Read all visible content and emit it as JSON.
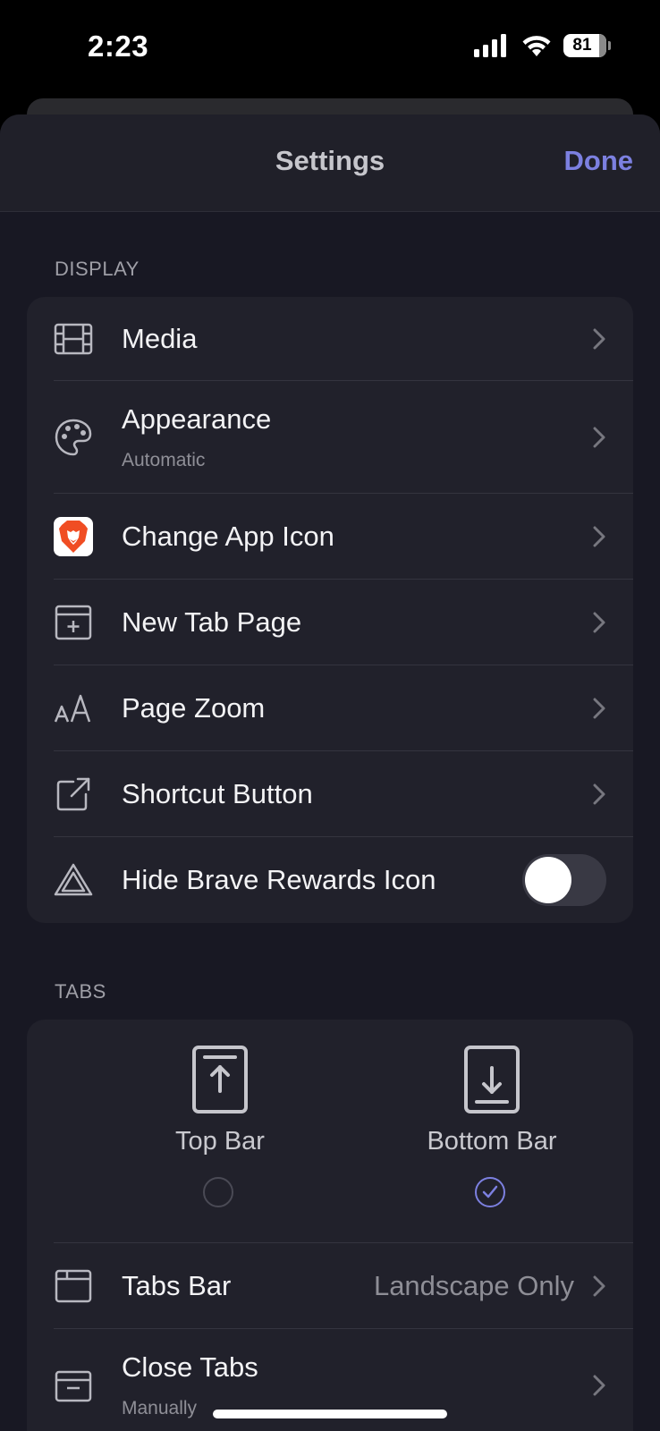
{
  "status_bar": {
    "time": "2:23",
    "battery": "81",
    "icons": [
      "cellular-signal-icon",
      "wifi-icon",
      "battery-icon"
    ]
  },
  "nav": {
    "title": "Settings",
    "done_label": "Done"
  },
  "display_section": {
    "header": "DISPLAY",
    "items": [
      {
        "label": "Media",
        "icon": "film-icon"
      },
      {
        "label": "Appearance",
        "subtitle": "Automatic",
        "icon": "palette-icon"
      },
      {
        "label": "Change App Icon",
        "icon": "brave-lion-icon"
      },
      {
        "label": "New Tab Page",
        "icon": "new-tab-icon"
      },
      {
        "label": "Page Zoom",
        "icon": "text-size-icon"
      },
      {
        "label": "Shortcut Button",
        "icon": "external-link-icon"
      },
      {
        "label": "Hide Brave Rewards Icon",
        "icon": "brave-rewards-icon",
        "toggle_on": false
      }
    ]
  },
  "tabs_section": {
    "header": "TABS",
    "bar_options": [
      {
        "label": "Top Bar",
        "selected": false,
        "icon": "top-bar-icon"
      },
      {
        "label": "Bottom Bar",
        "selected": true,
        "icon": "bottom-bar-icon"
      }
    ],
    "items": [
      {
        "label": "Tabs Bar",
        "value": "Landscape Only",
        "icon": "tabs-bar-icon"
      },
      {
        "label": "Close Tabs",
        "subtitle": "Manually",
        "icon": "close-tabs-icon"
      }
    ]
  },
  "colors": {
    "accent": "#7c80e0",
    "sheet_background": "#181823",
    "group_background": "#21212b",
    "brave_orange": "#f04d23"
  }
}
